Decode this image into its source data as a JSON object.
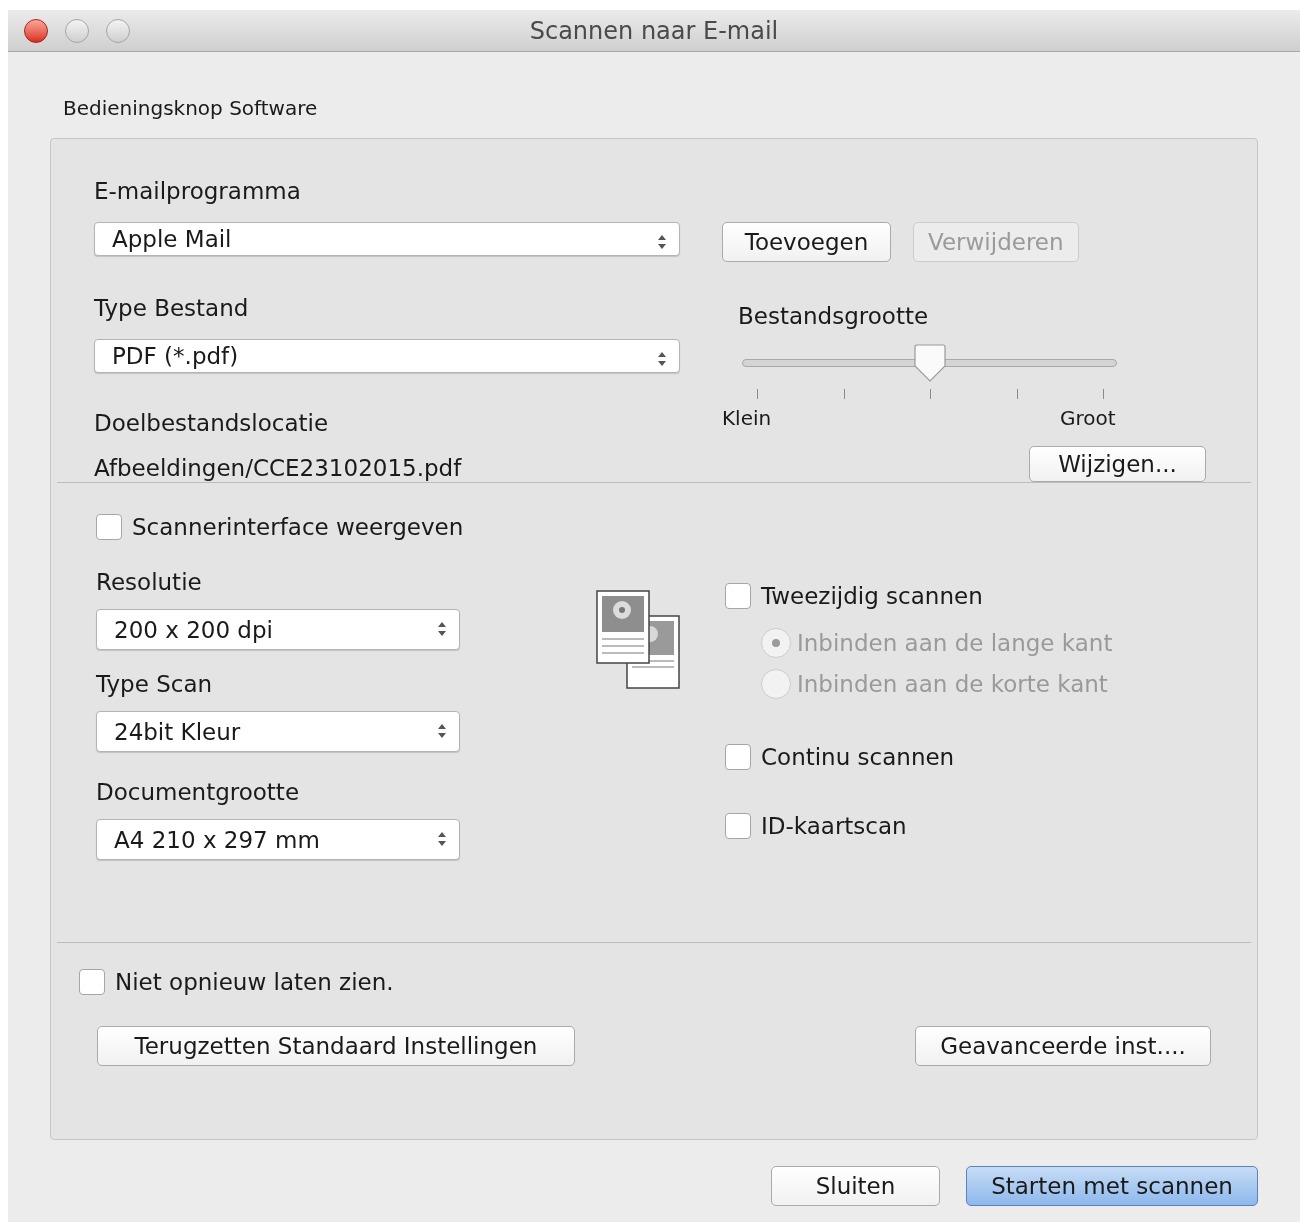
{
  "window": {
    "title": "Scannen naar E-mail"
  },
  "group_label": "Bedieningsknop Software",
  "email_program": {
    "label": "E-mailprogramma",
    "value": "Apple Mail"
  },
  "email_buttons": [
    {
      "label": "Toevoegen",
      "disabled": false
    },
    {
      "label": "Verwijderen",
      "disabled": true
    }
  ],
  "file_type": {
    "label": "Type Bestand",
    "value": "PDF (*.pdf)"
  },
  "file_size": {
    "label": "Bestandsgrootte",
    "level": 0.5,
    "min_label": "Klein",
    "max_label": "Groot"
  },
  "destination": {
    "label": "Doelbestandslocatie",
    "path": "Afbeeldingen/CCE23102015.pdf",
    "button": "Wijzigen..."
  },
  "show_scanner_interface": {
    "label": "Scannerinterface weergeven",
    "checked": false
  },
  "settings": [
    {
      "label": "Resolutie",
      "value": "200 x 200 dpi"
    },
    {
      "label": "Type Scan",
      "value": "24bit Kleur"
    },
    {
      "label": "Documentgrootte",
      "value": "A4 210 x 297 mm"
    }
  ],
  "options": [
    {
      "kind": "checkbox",
      "label": "Tweezijdig scannen",
      "checked": false
    },
    {
      "kind": "radio",
      "label": "Inbinden aan de lange kant",
      "selected": true,
      "disabled": true
    },
    {
      "kind": "radio",
      "label": "Inbinden aan de korte kant",
      "selected": false,
      "disabled": true
    },
    {
      "kind": "checkbox",
      "label": "Continu scannen",
      "checked": false
    },
    {
      "kind": "checkbox",
      "label": "ID-kaartscan",
      "checked": false
    }
  ],
  "dont_show_again": {
    "label": "Niet opnieuw laten zien.",
    "checked": false
  },
  "reset_button": "Terugzetten Standaard Instellingen",
  "advanced_button": "Geavanceerde inst....",
  "footer_buttons": [
    {
      "label": "Sluiten",
      "default": false
    },
    {
      "label": "Starten met scannen",
      "default": true
    }
  ]
}
